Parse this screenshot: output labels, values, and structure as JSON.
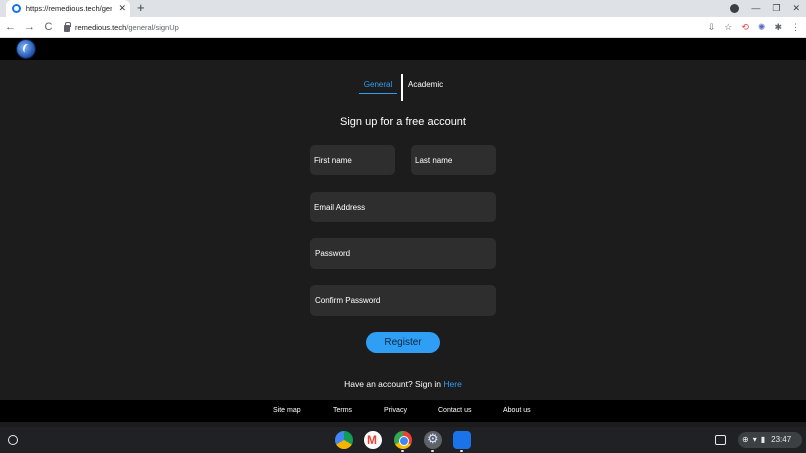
{
  "browser": {
    "tab_title": "https://remedious.tech/general/",
    "tab_close": "✕",
    "new_tab": "+",
    "url_host": "remedious.tech",
    "url_path": "/general/signUp",
    "back": "←",
    "forward": "→",
    "reload": "C",
    "window": {
      "minimize": "—",
      "maximize": "❐",
      "close": "✕"
    },
    "toolbar_icons": [
      "⇩",
      "☆",
      "⟲",
      "✺",
      "✱",
      "⋮"
    ]
  },
  "tabs": {
    "general": "General",
    "academic": "Academic"
  },
  "form": {
    "heading": "Sign up for a free account",
    "first_name": "First name",
    "last_name": "Last name",
    "email": "Email Address",
    "password": "Password",
    "confirm_password": "Confirm Password",
    "register": "Register"
  },
  "signin": {
    "prompt": "Have an account? Sign in ",
    "link": "Here"
  },
  "footer": {
    "site_map": "Site map",
    "terms": "Terms",
    "privacy": "Privacy",
    "contact": "Contact us",
    "about": "About us"
  },
  "shelf": {
    "time": "23:47"
  },
  "colors": {
    "accent": "#2f9ef5",
    "field_bg": "#2e2e2e",
    "page_bg": "#1c1c1c"
  }
}
